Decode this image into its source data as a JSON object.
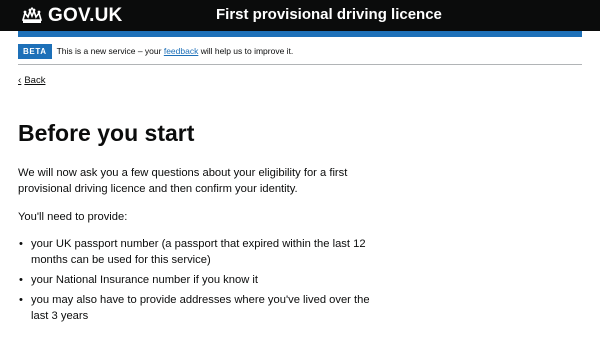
{
  "header": {
    "logo_text": "GOV.UK",
    "service_name": "First provisional driving licence"
  },
  "phase_banner": {
    "tag": "BETA",
    "text_before": "This is a new service – your ",
    "link_text": "feedback",
    "text_after": " will help us to improve it."
  },
  "back_link": {
    "label": "Back"
  },
  "main": {
    "title": "Before you start",
    "intro": "We will now ask you a few questions about your eligibility for a first provisional driving licence and then confirm your identity.",
    "need_text": "You'll need to provide:",
    "requirements": [
      "your UK passport number (a passport that expired within the last 12 months can be used for this service)",
      "your National Insurance number if you know it",
      "you may also have to provide addresses where you've lived over the last 3 years"
    ]
  },
  "colors": {
    "header_bg": "#0b0c0c",
    "brand_blue": "#1d70b8",
    "text": "#0b0c0c",
    "link": "#1d70b8"
  },
  "icons": {
    "logo": "crown-icon",
    "back": "chevron-left-icon"
  }
}
